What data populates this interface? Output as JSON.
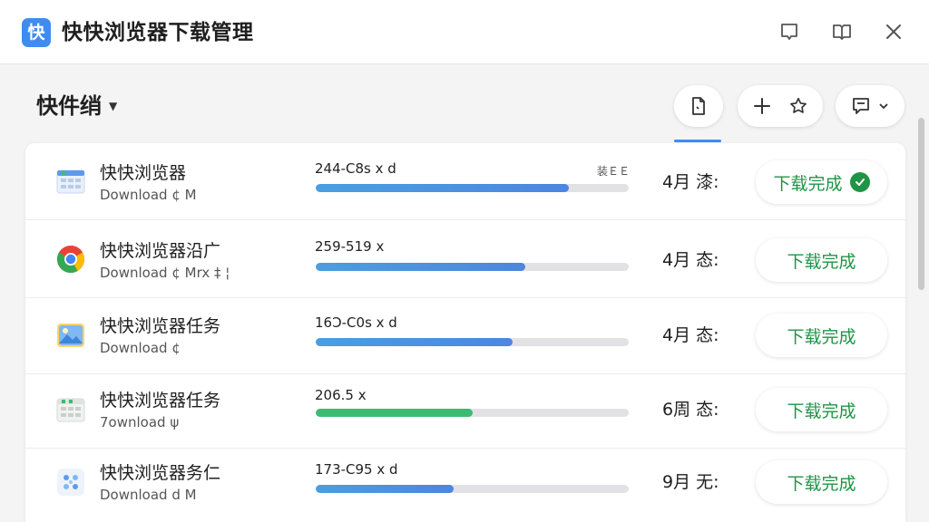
{
  "window": {
    "logo_char": "快",
    "title": "快快浏览器下载管理"
  },
  "toolbar": {
    "folder_label": "快件绡"
  },
  "colors": {
    "accent": "#3f8cf0",
    "success": "#1f9447",
    "bar_blue": "#4d86e0",
    "bar_green": "#3fba73"
  },
  "downloads": [
    {
      "name": "快快浏览器",
      "sub": "Download ¢ M",
      "speed": "244-C8s x d",
      "extra": "装ＥＥ",
      "progress": 0.81,
      "bar_color": "blue",
      "when": "4月 漆:",
      "status": "下载完成",
      "icon": "spreadsheet-icon",
      "checked": true
    },
    {
      "name": "快快浏览器沿广",
      "sub": "Download ¢ Mrx ‡ ¦",
      "speed": "259-519 x",
      "extra": "",
      "progress": 0.67,
      "bar_color": "blue",
      "when": "4月 态:",
      "status": "下载完成",
      "icon": "chrome-icon",
      "checked": false
    },
    {
      "name": "快快浏览器任务",
      "sub": "Download ¢",
      "speed": "16Ɔ-C0s x d",
      "extra": "",
      "progress": 0.63,
      "bar_color": "blue",
      "when": "4月 态:",
      "status": "下载完成",
      "icon": "image-icon",
      "checked": false
    },
    {
      "name": "快快浏览器任务",
      "sub": "7ownload ψ",
      "speed": "206.5 x",
      "extra": "",
      "progress": 0.5,
      "bar_color": "green",
      "when": "6周 态:",
      "status": "下载完成",
      "icon": "spreadsheet-icon",
      "checked": false
    },
    {
      "name": "快快浏览器务仁",
      "sub": "Download d M",
      "speed": "173-C95 x d",
      "extra": "",
      "progress": 0.44,
      "bar_color": "blue",
      "when": "9月 无:",
      "status": "下载完成",
      "icon": "dots-icon",
      "checked": false
    }
  ]
}
